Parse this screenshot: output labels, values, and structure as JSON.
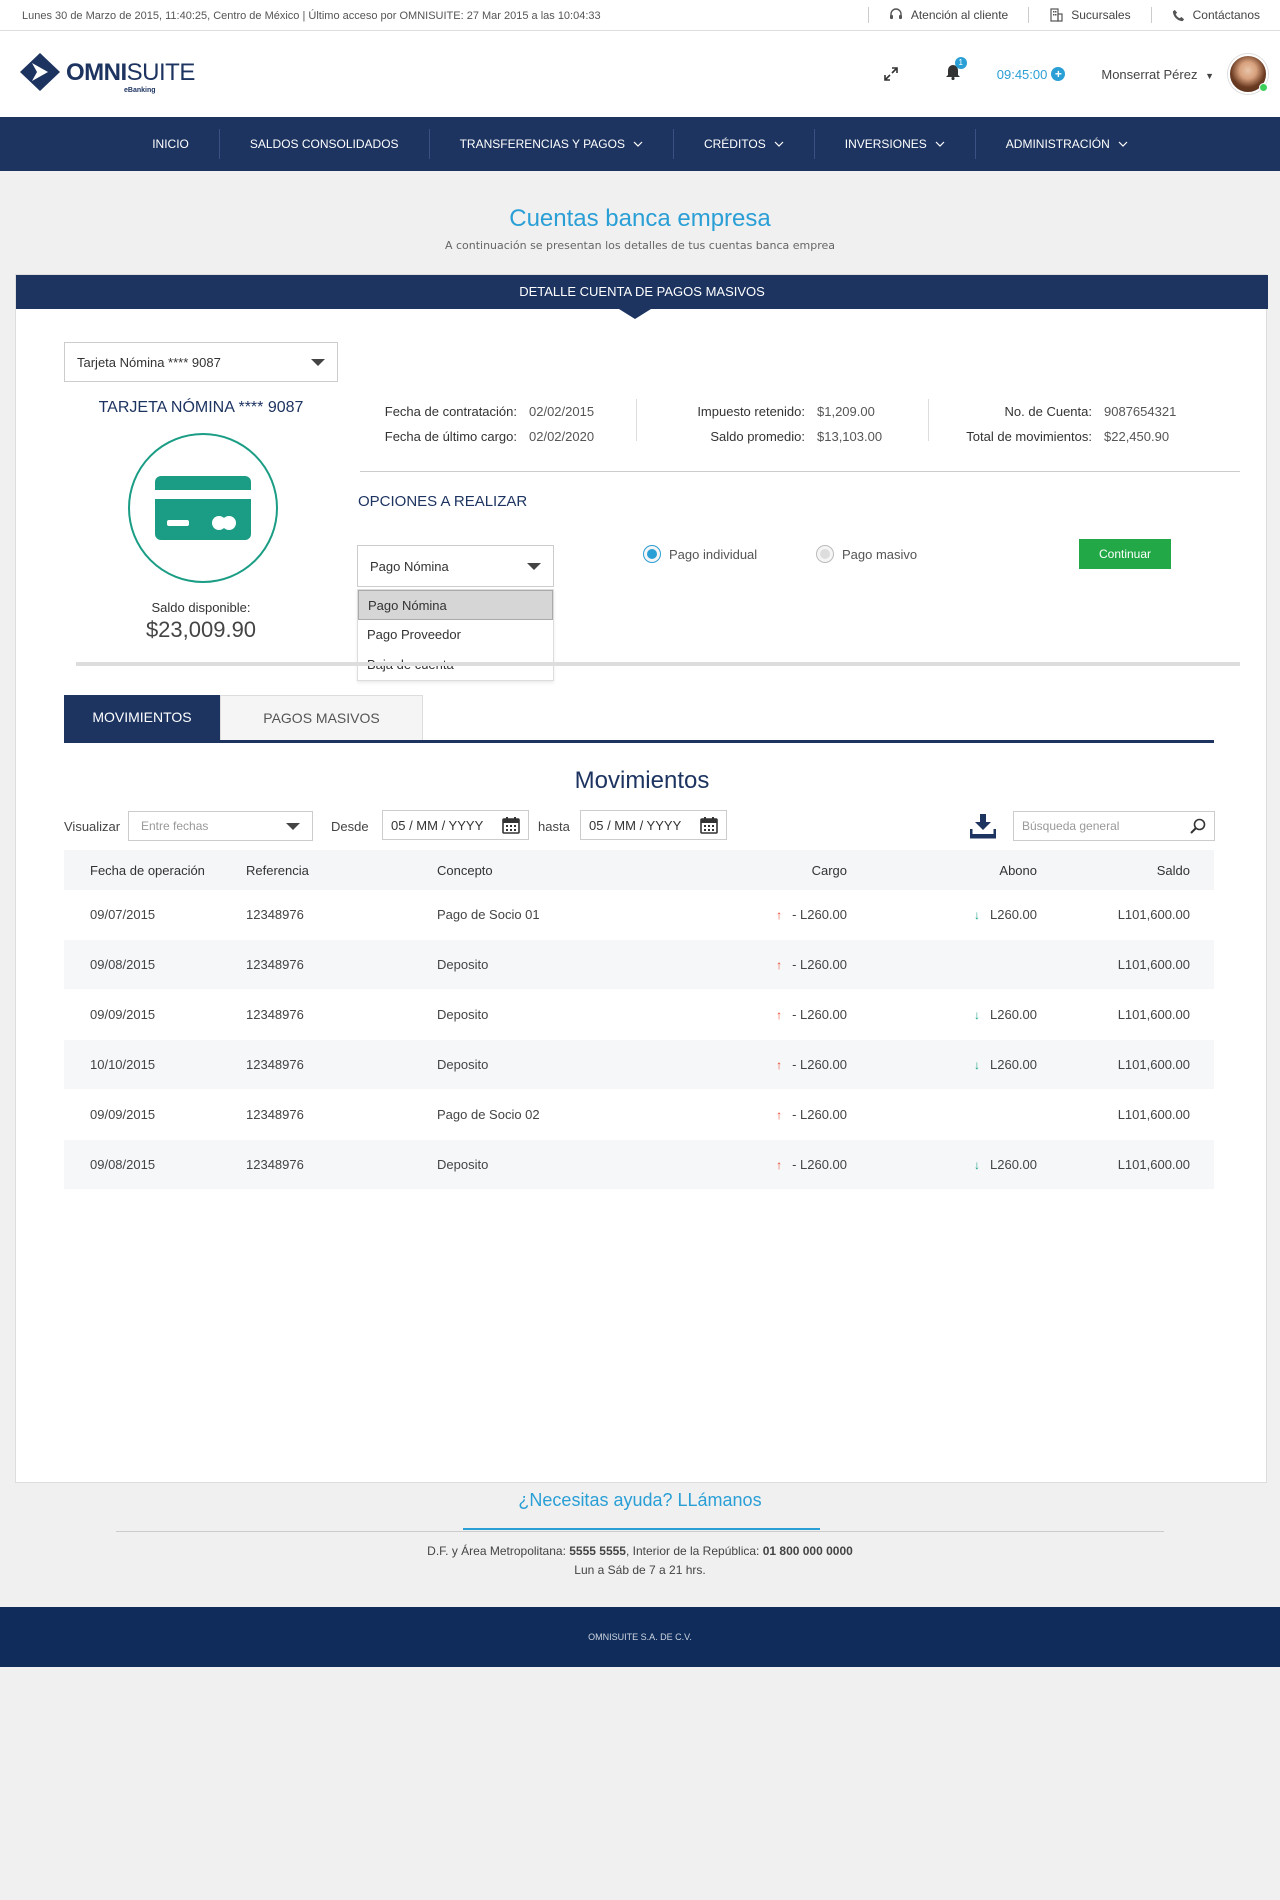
{
  "topbar": {
    "status": "Lunes 30 de Marzo de 2015, 11:40:25,  Centro de México | Último acceso por OMNISUITE: 27 Mar 2015 a las 10:04:33",
    "links": [
      "Atención al cliente",
      "Sucursales",
      "Contáctanos"
    ]
  },
  "header": {
    "logo_bold": "OMNI",
    "logo_light": "SUITE",
    "logo_sub": "eBanking",
    "notifications": "1",
    "time": "09:45:00",
    "user": "Monserrat Pérez"
  },
  "nav": [
    "INICIO",
    "SALDOS CONSOLIDADOS",
    "TRANSFERENCIAS Y PAGOS",
    "CRÉDITOS",
    "INVERSIONES",
    "ADMINISTRACIÓN"
  ],
  "page": {
    "title": "Cuentas banca empresa",
    "subtitle": "A continuación se presentan los detalles de tus cuentas banca emprea"
  },
  "panel": {
    "bar_title": "DETALLE CUENTA DE PAGOS MASIVOS",
    "account_select": "Tarjeta Nómina **** 9087",
    "card_name": "TARJETA NÓMINA **** 9087",
    "saldo_label": "Saldo disponible:",
    "saldo_value": "$23,009.90",
    "info": {
      "fecha_contratacion_k": "Fecha de contratación:",
      "fecha_contratacion_v": "02/02/2015",
      "fecha_ultimo_k": "Fecha de último cargo:",
      "fecha_ultimo_v": "02/02/2020",
      "impuesto_k": "Impuesto retenido:",
      "impuesto_v": "$1,209.00",
      "saldo_prom_k": "Saldo promedio:",
      "saldo_prom_v": "$13,103.00",
      "no_cuenta_k": "No. de Cuenta:",
      "no_cuenta_v": "9087654321",
      "total_mov_k": "Total de movimientos:",
      "total_mov_v": "$22,450.90"
    },
    "options_title": "OPCIONES A REALIZAR",
    "option_select": "Pago  Nómina",
    "dropdown": [
      "Pago  Nómina",
      "Pago Proveedor",
      "Baja de cuenta"
    ],
    "radio_individual": "Pago individual",
    "radio_masivo": "Pago masivo",
    "continue": "Continuar"
  },
  "tabs": [
    "MOVIMIENTOS",
    "PAGOS MASIVOS"
  ],
  "movements": {
    "title": "Movimientos",
    "visualizar": "Visualizar",
    "visualizar_placeholder": "Entre fechas",
    "desde": "Desde",
    "hasta": "hasta",
    "date_from": "05 / MM / YYYY",
    "date_to": "05 / MM / YYYY",
    "search_placeholder": "Búsqueda general",
    "headers": [
      "Fecha de operación",
      "Referencia",
      "Concepto",
      "Cargo",
      "Abono",
      "Saldo"
    ],
    "rows": [
      {
        "fecha": "09/07/2015",
        "ref": "12348976",
        "concepto": "Pago de Socio 01",
        "cargo": "- L260.00",
        "abono": "L260.00",
        "saldo": "L101,600.00"
      },
      {
        "fecha": "09/08/2015",
        "ref": "12348976",
        "concepto": "Deposito",
        "cargo": "- L260.00",
        "abono": "",
        "saldo": "L101,600.00"
      },
      {
        "fecha": "09/09/2015",
        "ref": "12348976",
        "concepto": "Deposito",
        "cargo": "- L260.00",
        "abono": "L260.00",
        "saldo": "L101,600.00"
      },
      {
        "fecha": "10/10/2015",
        "ref": "12348976",
        "concepto": "Deposito",
        "cargo": "- L260.00",
        "abono": "L260.00",
        "saldo": "L101,600.00"
      },
      {
        "fecha": "09/09/2015",
        "ref": "12348976",
        "concepto": "Pago de Socio 02",
        "cargo": "- L260.00",
        "abono": "",
        "saldo": "L101,600.00"
      },
      {
        "fecha": "09/08/2015",
        "ref": "12348976",
        "concepto": "Deposito",
        "cargo": "- L260.00",
        "abono": "L260.00",
        "saldo": "L101,600.00"
      }
    ]
  },
  "help": {
    "title": "¿Necesitas ayuda? LLámanos",
    "phone_a": "D.F. y Área Metropolitana: ",
    "phone_a_num": "5555 5555",
    "phone_b": ", Interior de la República: ",
    "phone_b_num": "01 800 000 0000",
    "hours": "Lun a Sáb de 7 a 21 hrs."
  },
  "footer": "OMNISUITE S.A. DE C.V.",
  "colors": {
    "navy": "#1d3461",
    "accent": "#2a9fd6",
    "green": "#23a847",
    "teal": "#1a9d84"
  }
}
